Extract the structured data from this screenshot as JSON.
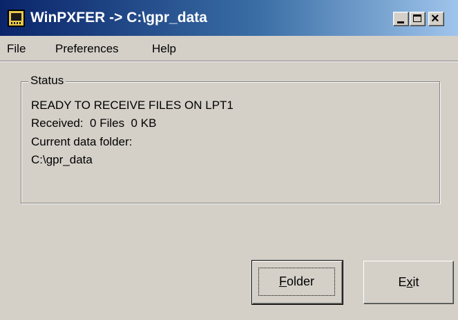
{
  "window": {
    "title": "WinPXFER -> C:\\gpr_data",
    "icon": "app-icon",
    "controls": [
      "minimize-icon",
      "maximize-icon",
      "close-icon"
    ]
  },
  "menu": {
    "file": "File",
    "preferences": "Preferences",
    "help": "Help"
  },
  "status": {
    "legend": "Status",
    "line1": "READY TO RECEIVE FILES ON LPT1",
    "line2": "Received:  0 Files  0 KB",
    "line3": "Current data folder:",
    "line4": "C:\\gpr_data"
  },
  "buttons": {
    "folder_accel": "F",
    "folder_rest": "older",
    "exit_pre": "E",
    "exit_accel": "x",
    "exit_rest": "it"
  },
  "colors": {
    "titlebar_start": "#0a246a",
    "titlebar_end": "#a6caf0",
    "face": "#d4d0c8"
  }
}
